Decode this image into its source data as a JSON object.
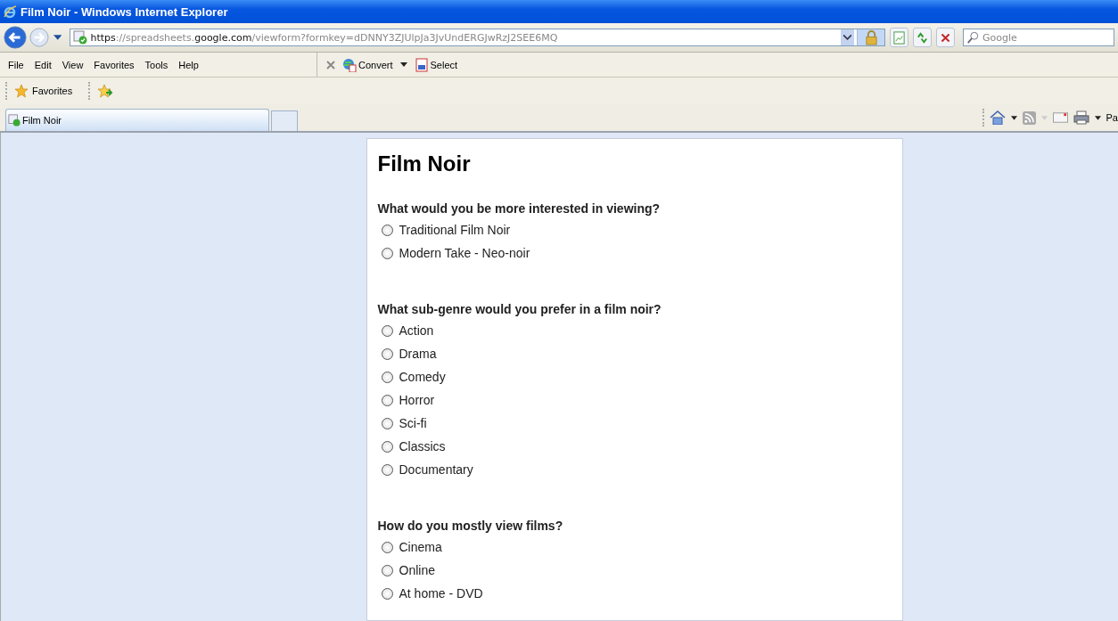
{
  "window": {
    "title": "Film Noir - Windows Internet Explorer"
  },
  "address_bar": {
    "url_parts": [
      {
        "text": "https",
        "emphasis": true
      },
      {
        "text": "://spreadsheets.",
        "emphasis": false
      },
      {
        "text": "google.com",
        "emphasis": true
      },
      {
        "text": "/viewform?formkey=dDNNY3ZJUlpJa3JvUndERGJwRzJ2SEE6MQ",
        "emphasis": false
      }
    ]
  },
  "search": {
    "placeholder": "Google"
  },
  "menu": [
    "File",
    "Edit",
    "View",
    "Favorites",
    "Tools",
    "Help"
  ],
  "addon_toolbar": [
    "Convert",
    "Select"
  ],
  "favorites_bar": {
    "label": "Favorites"
  },
  "tabs": [
    {
      "label": "Film Noir",
      "selected": true
    }
  ],
  "command_bar": {
    "cut_label": "Pa"
  },
  "form": {
    "title": "Film Noir",
    "questions": [
      {
        "text": "What would you be more interested in viewing?",
        "options": [
          {
            "label": "Traditional Film Noir",
            "selected": false
          },
          {
            "label": "Modern Take - Neo-noir",
            "selected": false
          }
        ]
      },
      {
        "text": "What sub-genre would you prefer in a film noir?",
        "options": [
          {
            "label": "Action",
            "selected": false
          },
          {
            "label": "Drama",
            "selected": false
          },
          {
            "label": "Comedy",
            "selected": false
          },
          {
            "label": "Horror",
            "selected": false
          },
          {
            "label": "Sci-fi",
            "selected": false
          },
          {
            "label": "Classics",
            "selected": false
          },
          {
            "label": "Documentary",
            "selected": false
          }
        ]
      },
      {
        "text": "How do you mostly view films?",
        "options": [
          {
            "label": "Cinema",
            "selected": false
          },
          {
            "label": "Online",
            "selected": false
          },
          {
            "label": "At home - DVD",
            "selected": false
          }
        ]
      }
    ]
  }
}
